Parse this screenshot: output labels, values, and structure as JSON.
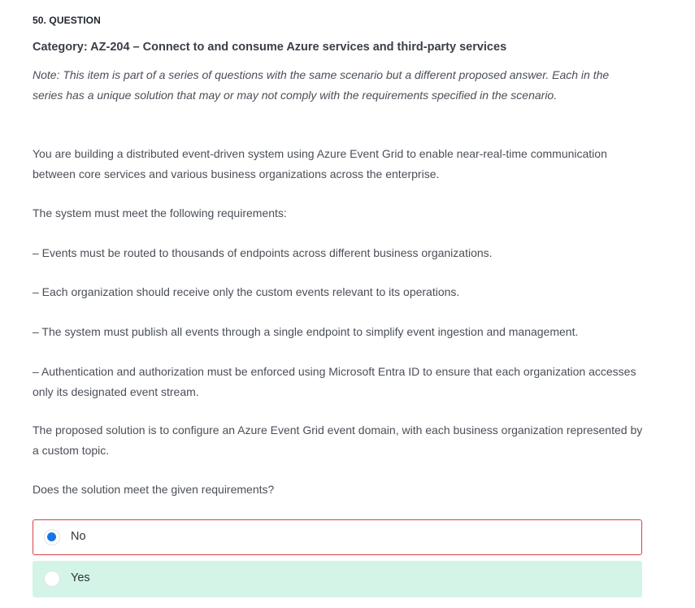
{
  "question": {
    "number_label": "50. QUESTION",
    "category": "Category: AZ-204 – Connect to and consume Azure services and third-party services",
    "note": "Note: This item is part of a series of questions with the same scenario but a different proposed answer. Each in the series has a unique solution that may or may not comply with the requirements specified in the scenario.",
    "paragraphs": [
      "You are building a distributed event-driven system using Azure Event Grid to enable near-real-time communication between core services and various business organizations across the enterprise.",
      "The system must meet the following requirements:",
      "– Events must be routed to thousands of endpoints across different business organizations.",
      "– Each organization should receive only the custom events relevant to its operations.",
      "– The system must publish all events through a single endpoint to simplify event ingestion and management.",
      "– Authentication and authorization must be enforced using Microsoft Entra ID to ensure that each organization accesses only its designated event stream.",
      "The proposed solution is to configure an Azure Event Grid event domain, with each business organization represented by a custom topic.",
      "Does the solution meet the given requirements?"
    ]
  },
  "answers": [
    {
      "label": "No",
      "selected": true,
      "status": "incorrect"
    },
    {
      "label": "Yes",
      "selected": false,
      "status": "correct"
    }
  ],
  "colors": {
    "selected_radio": "#1a73e8",
    "incorrect_border": "#d7404b",
    "correct_background": "#d4f4e8"
  }
}
